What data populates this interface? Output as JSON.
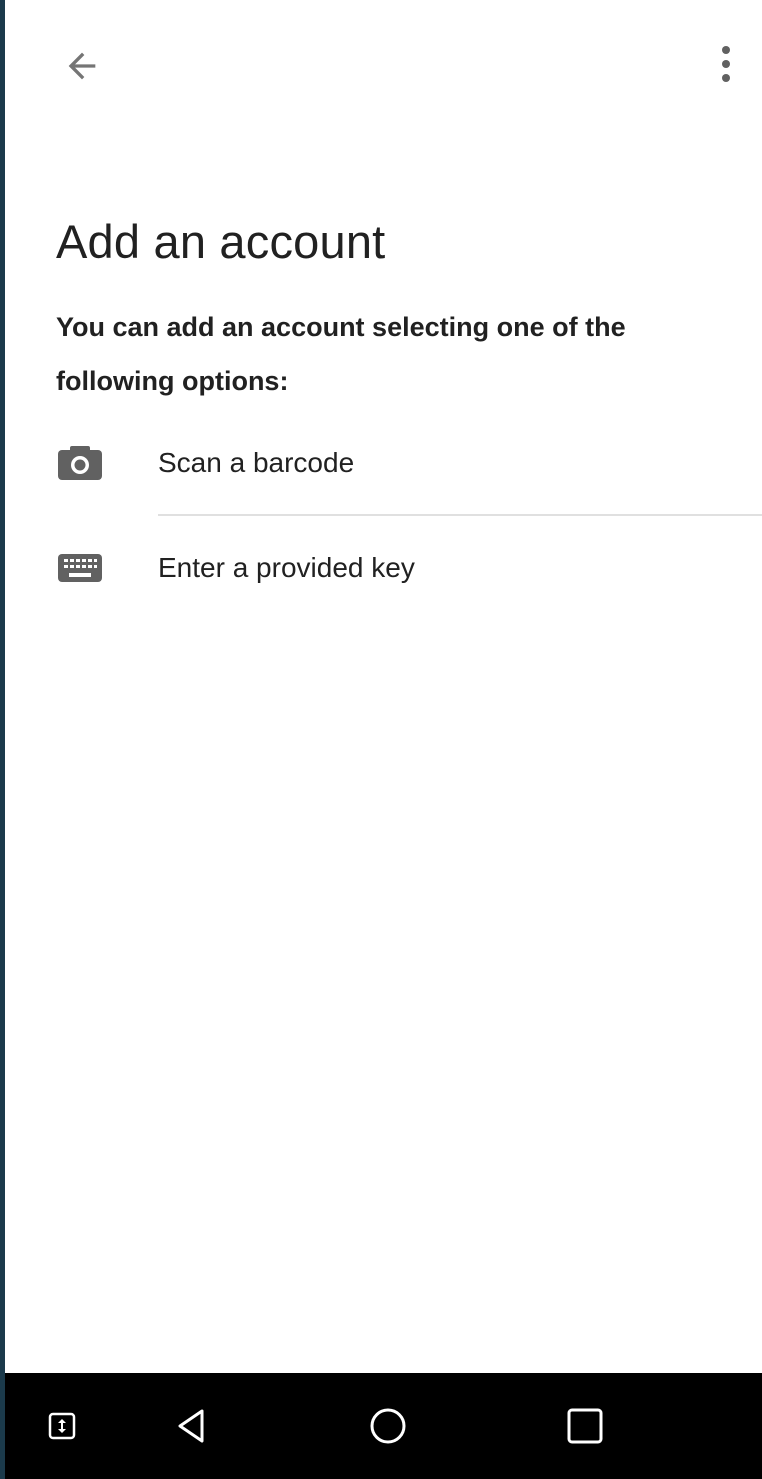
{
  "toolbar": {
    "back_icon": "arrow-back-icon",
    "menu_icon": "more-vert-icon"
  },
  "page": {
    "title": "Add an account",
    "subtitle": "You can add an account selecting one of the following options:"
  },
  "options": [
    {
      "icon": "camera-icon",
      "label": "Scan a barcode"
    },
    {
      "icon": "keyboard-icon",
      "label": "Enter a provided key"
    }
  ],
  "colors": {
    "icon_gray": "#616161",
    "text": "#212121",
    "divider": "#e0e0e0",
    "navbar": "#000000",
    "left_strip": "#1b3a4b"
  },
  "navbar": {
    "items": [
      "swap-vertical-icon",
      "nav-back-icon",
      "nav-home-icon",
      "nav-recents-icon"
    ]
  }
}
